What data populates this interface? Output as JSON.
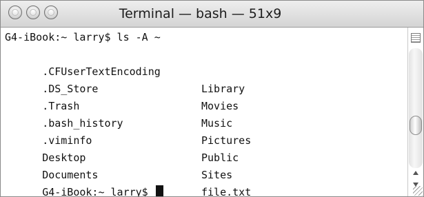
{
  "window": {
    "title": "Terminal — bash — 51x9"
  },
  "terminal": {
    "prompt_line": "G4-iBook:~ larry$ ls -A ~",
    "rows": [
      {
        "left": ".CFUserTextEncoding",
        "right": "Library"
      },
      {
        "left": ".DS_Store",
        "right": "Movies"
      },
      {
        "left": ".Trash",
        "right": "Music"
      },
      {
        "left": ".bash_history",
        "right": "Pictures"
      },
      {
        "left": ".viminfo",
        "right": "Public"
      },
      {
        "left": "Desktop",
        "right": "Sites"
      },
      {
        "left": "Documents",
        "right": "file.txt"
      }
    ],
    "final_prompt": "G4-iBook:~ larry$ "
  },
  "icons": {
    "close": "close-icon",
    "minimize": "minimize-icon",
    "zoom": "zoom-icon",
    "split": "split-pane-icon",
    "scroll_up": "arrow-up-icon",
    "scroll_down": "arrow-down-icon",
    "resize": "resize-grip-icon"
  }
}
